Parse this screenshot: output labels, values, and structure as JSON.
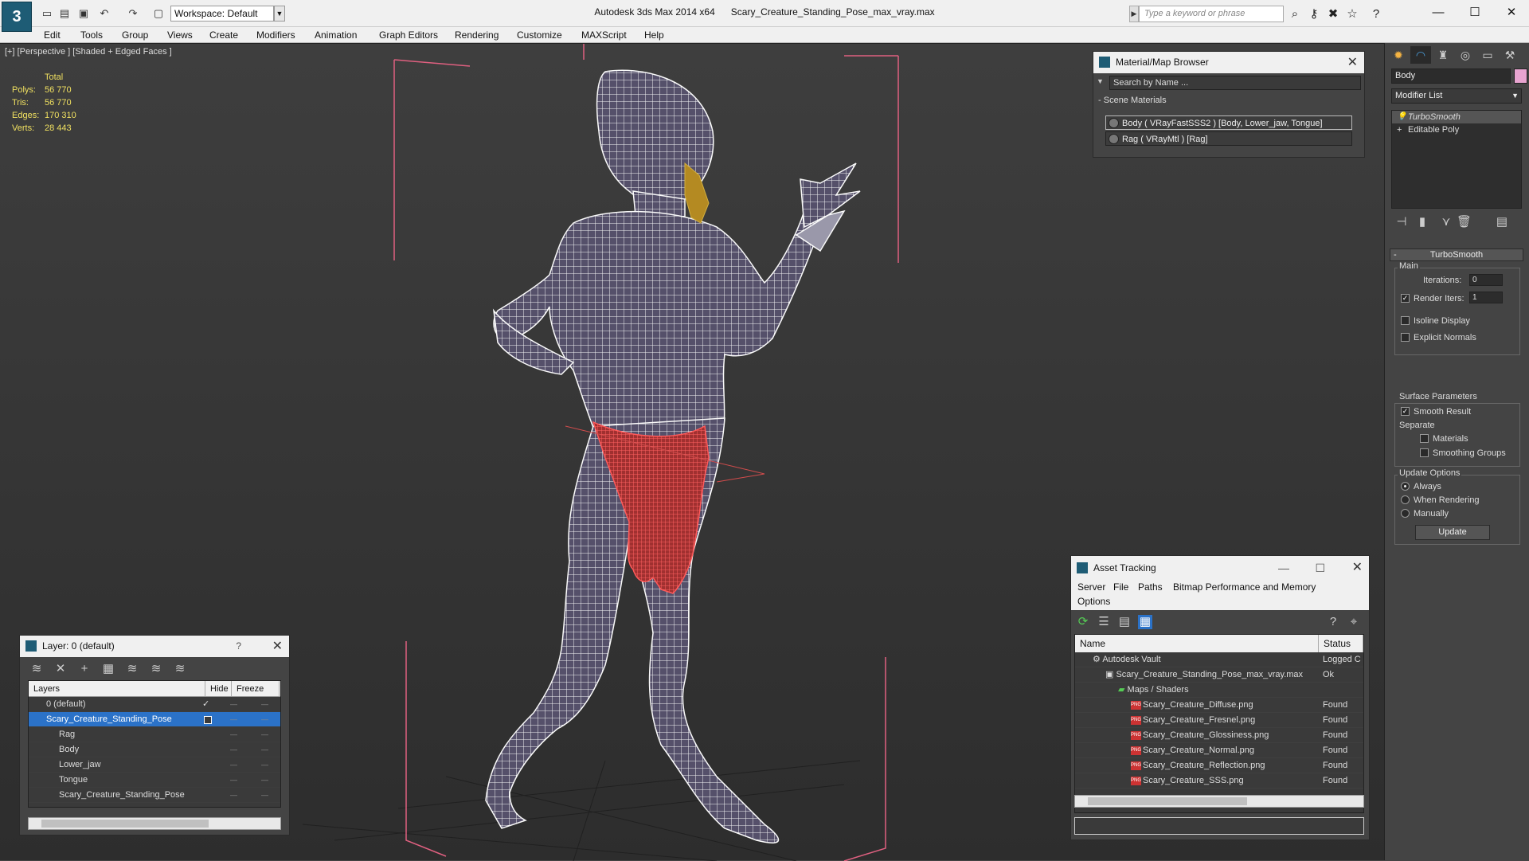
{
  "app": {
    "title": "Autodesk 3ds Max  2014 x64",
    "filename": "Scary_Creature_Standing_Pose_max_vray.max",
    "workspace": "Workspace: Default",
    "search_placeholder": "Type a keyword or phrase"
  },
  "menu": [
    "Edit",
    "Tools",
    "Group",
    "Views",
    "Create",
    "Modifiers",
    "Animation",
    "Graph Editors",
    "Rendering",
    "Customize",
    "MAXScript",
    "Help"
  ],
  "viewport": {
    "label": "[+] [Perspective ] [Shaded + Edged Faces ]",
    "stats": {
      "header": "Total",
      "rows": [
        {
          "k": "Polys:",
          "v": "56 770"
        },
        {
          "k": "Tris:",
          "v": "56 770"
        },
        {
          "k": "Edges:",
          "v": "170 310"
        },
        {
          "k": "Verts:",
          "v": "28 443"
        }
      ]
    }
  },
  "layer_panel": {
    "title": "Layer: 0 (default)",
    "help": "?",
    "columns": [
      "Layers",
      "Hide",
      "Freeze"
    ],
    "rows": [
      {
        "name": "0 (default)"
      },
      {
        "name": "Scary_Creature_Standing_Pose"
      },
      {
        "name": "Rag"
      },
      {
        "name": "Body"
      },
      {
        "name": "Lower_jaw"
      },
      {
        "name": "Tongue"
      },
      {
        "name": "Scary_Creature_Standing_Pose"
      }
    ]
  },
  "material_browser": {
    "title": "Material/Map Browser",
    "search": "Search by Name ...",
    "section": "Scene Materials",
    "items": [
      "Body  ( VRayFastSSS2 ) [Body, Lower_jaw, Tongue]",
      "Rag  ( VRayMtl ) [Rag]"
    ]
  },
  "asset_tracking": {
    "title": "Asset Tracking",
    "menu": [
      "Server",
      "File",
      "Paths",
      "Bitmap Performance and Memory",
      "Options"
    ],
    "columns": [
      "Name",
      "Status"
    ],
    "rows": [
      {
        "name": "Autodesk Vault",
        "status": "Logged C"
      },
      {
        "name": "Scary_Creature_Standing_Pose_max_vray.max",
        "status": "Ok"
      },
      {
        "name": "Maps / Shaders",
        "status": ""
      },
      {
        "name": "Scary_Creature_Diffuse.png",
        "status": "Found"
      },
      {
        "name": "Scary_Creature_Fresnel.png",
        "status": "Found"
      },
      {
        "name": "Scary_Creature_Glossiness.png",
        "status": "Found"
      },
      {
        "name": "Scary_Creature_Normal.png",
        "status": "Found"
      },
      {
        "name": "Scary_Creature_Reflection.png",
        "status": "Found"
      },
      {
        "name": "Scary_Creature_SSS.png",
        "status": "Found"
      }
    ]
  },
  "command_panel": {
    "object_name": "Body",
    "modifier_list": "Modifier List",
    "stack": [
      "TurboSmooth",
      "Editable Poly"
    ],
    "rollout_title": "TurboSmooth",
    "main_label": "Main",
    "iterations_label": "Iterations:",
    "iterations_value": "0",
    "render_iters_label": "Render Iters:",
    "render_iters_value": "1",
    "isoline_label": "Isoline Display",
    "explicit_normals_label": "Explicit Normals",
    "surface_params_label": "Surface Parameters",
    "smooth_result_label": "Smooth Result",
    "separate_label": "Separate",
    "materials_label": "Materials",
    "smoothing_groups_label": "Smoothing Groups",
    "update_options_label": "Update Options",
    "always_label": "Always",
    "when_rendering_label": "When Rendering",
    "manually_label": "Manually",
    "update_button": "Update"
  },
  "colors": {
    "wire": "#ffffff",
    "rag": "#e04848",
    "box": "#e06080",
    "accent": "#2b72c8"
  }
}
